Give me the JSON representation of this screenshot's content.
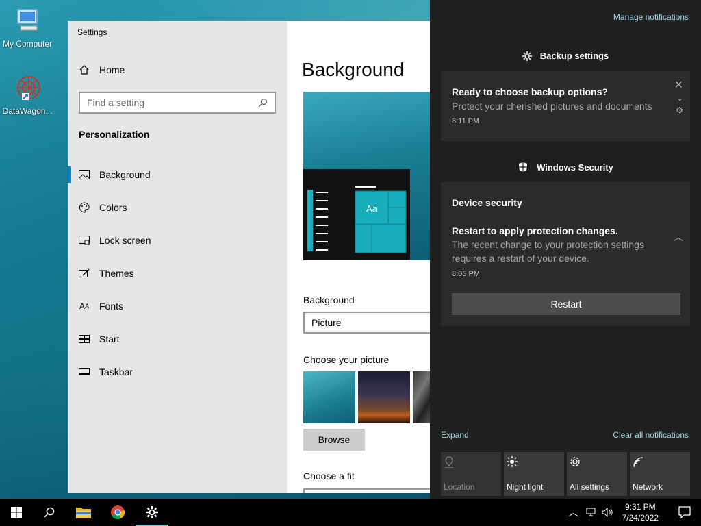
{
  "desktop": {
    "icons": [
      {
        "label": "My Computer",
        "icon": "monitor-icon"
      },
      {
        "label": "DataWagon...",
        "icon": "datawagon-icon"
      }
    ]
  },
  "settings": {
    "window_title": "Settings",
    "home_label": "Home",
    "search_placeholder": "Find a setting",
    "section_title": "Personalization",
    "nav": [
      {
        "label": "Background",
        "icon": "picture-icon",
        "active": true
      },
      {
        "label": "Colors",
        "icon": "palette-icon"
      },
      {
        "label": "Lock screen",
        "icon": "lock-screen-icon"
      },
      {
        "label": "Themes",
        "icon": "brush-icon"
      },
      {
        "label": "Fonts",
        "icon": "fonts-icon"
      },
      {
        "label": "Start",
        "icon": "start-icon"
      },
      {
        "label": "Taskbar",
        "icon": "taskbar-icon"
      }
    ],
    "page_title": "Background",
    "preview_sample": "Aa",
    "background_label": "Background",
    "background_value": "Picture",
    "choose_picture_label": "Choose your picture",
    "browse_label": "Browse",
    "choose_fit_label": "Choose a fit"
  },
  "action_center": {
    "manage_label": "Manage notifications",
    "groups": [
      {
        "app": "Backup settings",
        "icon": "gear-icon",
        "title": "Ready to choose backup options?",
        "body": "Protect your cherished pictures and documents",
        "time": "8:11 PM"
      },
      {
        "app": "Windows Security",
        "icon": "shield-icon",
        "subtitle": "Device security",
        "title": "Restart to apply protection changes.",
        "body_line1": "The recent change to your protection settings",
        "body_line2": "requires a restart of your device.",
        "time": "8:05 PM",
        "action_label": "Restart"
      }
    ],
    "expand_label": "Expand",
    "clear_label": "Clear all notifications",
    "quick_actions": [
      {
        "label": "Location",
        "icon": "location-icon",
        "enabled": false
      },
      {
        "label": "Night light",
        "icon": "brightness-icon",
        "enabled": true
      },
      {
        "label": "All settings",
        "icon": "gear-icon",
        "enabled": true
      },
      {
        "label": "Network",
        "icon": "network-icon",
        "enabled": true
      }
    ]
  },
  "taskbar": {
    "time": "9:31 PM",
    "date": "7/24/2022"
  },
  "colors": {
    "accent": "#0b80c8",
    "action_bg": "#1f1f1f",
    "link": "#9fd8e6"
  }
}
